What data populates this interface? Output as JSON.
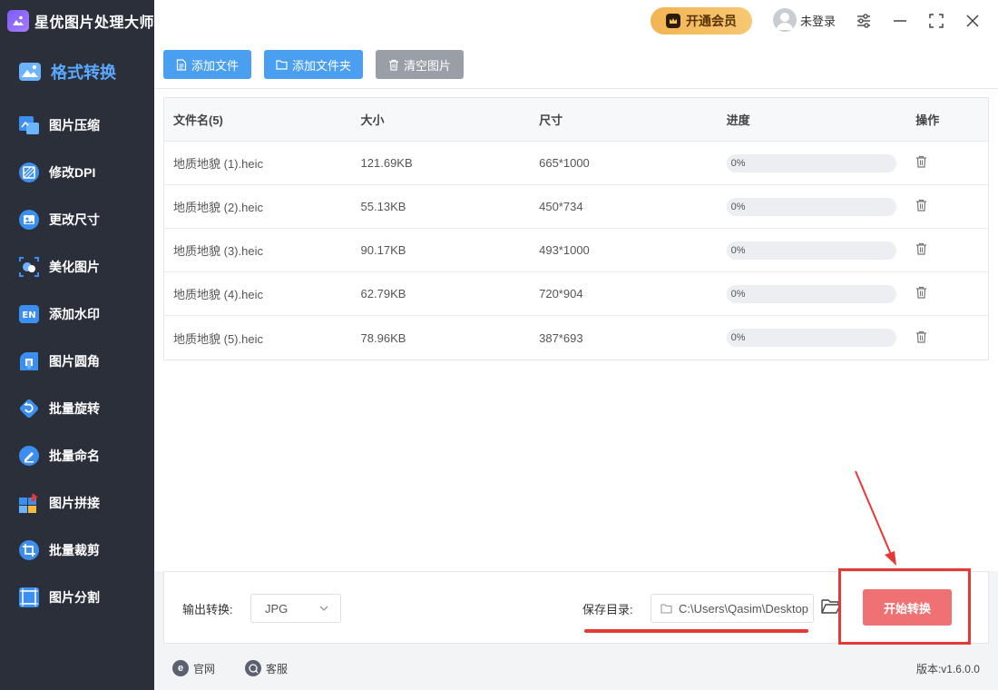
{
  "app": {
    "title": "星优图片处理大师"
  },
  "sidebar": {
    "items": [
      {
        "label": "格式转换",
        "icon": "image-icon",
        "color": "#5aa9ff"
      },
      {
        "label": "图片压缩",
        "icon": "compress-icon",
        "color": "#3b8ff0"
      },
      {
        "label": "修改DPI",
        "icon": "dpi-icon",
        "color": "#3b8ff0"
      },
      {
        "label": "更改尺寸",
        "icon": "resize-icon",
        "color": "#3b8ff0"
      },
      {
        "label": "美化图片",
        "icon": "beautify-icon",
        "color": "#3b8ff0"
      },
      {
        "label": "添加水印",
        "icon": "watermark-icon",
        "color": "#3b8ff0"
      },
      {
        "label": "图片圆角",
        "icon": "round-corner-icon",
        "color": "#3b8ff0"
      },
      {
        "label": "批量旋转",
        "icon": "rotate-icon",
        "color": "#3b8ff0"
      },
      {
        "label": "批量命名",
        "icon": "rename-icon",
        "color": "#3b8ff0"
      },
      {
        "label": "图片拼接",
        "icon": "puzzle-icon",
        "color": "#3b8ff0"
      },
      {
        "label": "批量裁剪",
        "icon": "crop-icon",
        "color": "#3b8ff0"
      },
      {
        "label": "图片分割",
        "icon": "split-icon",
        "color": "#3b8ff0"
      }
    ]
  },
  "header": {
    "vip_label": "开通会员",
    "user_label": "未登录"
  },
  "toolbar": {
    "add_file": "添加文件",
    "add_folder": "添加文件夹",
    "clear": "清空图片"
  },
  "table": {
    "headers": [
      "文件名(5)",
      "大小",
      "尺寸",
      "进度",
      "操作"
    ],
    "rows": [
      {
        "name": "地质地貌 (1).heic",
        "size": "121.69KB",
        "dims": "665*1000",
        "progress": "0%",
        "progress_value": 0
      },
      {
        "name": "地质地貌 (2).heic",
        "size": "55.13KB",
        "dims": "450*734",
        "progress": "0%",
        "progress_value": 0
      },
      {
        "name": "地质地貌 (3).heic",
        "size": "90.17KB",
        "dims": "493*1000",
        "progress": "0%",
        "progress_value": 0
      },
      {
        "name": "地质地貌 (4).heic",
        "size": "62.79KB",
        "dims": "720*904",
        "progress": "0%",
        "progress_value": 0
      },
      {
        "name": "地质地貌 (5).heic",
        "size": "78.96KB",
        "dims": "387*693",
        "progress": "0%",
        "progress_value": 0
      }
    ]
  },
  "bottom": {
    "output_label": "输出转换:",
    "output_format": "JPG",
    "save_label": "保存目录:",
    "save_path": "C:\\Users\\Qasim\\Desktop",
    "start_label": "开始转换"
  },
  "footer": {
    "website": "官网",
    "support": "客服",
    "version": "版本:v1.6.0.0"
  },
  "colors": {
    "accent_blue": "#4a9ff0",
    "start_red": "#f07174",
    "annotation_red": "#e53935",
    "sidebar_bg": "#2b2f3a"
  }
}
